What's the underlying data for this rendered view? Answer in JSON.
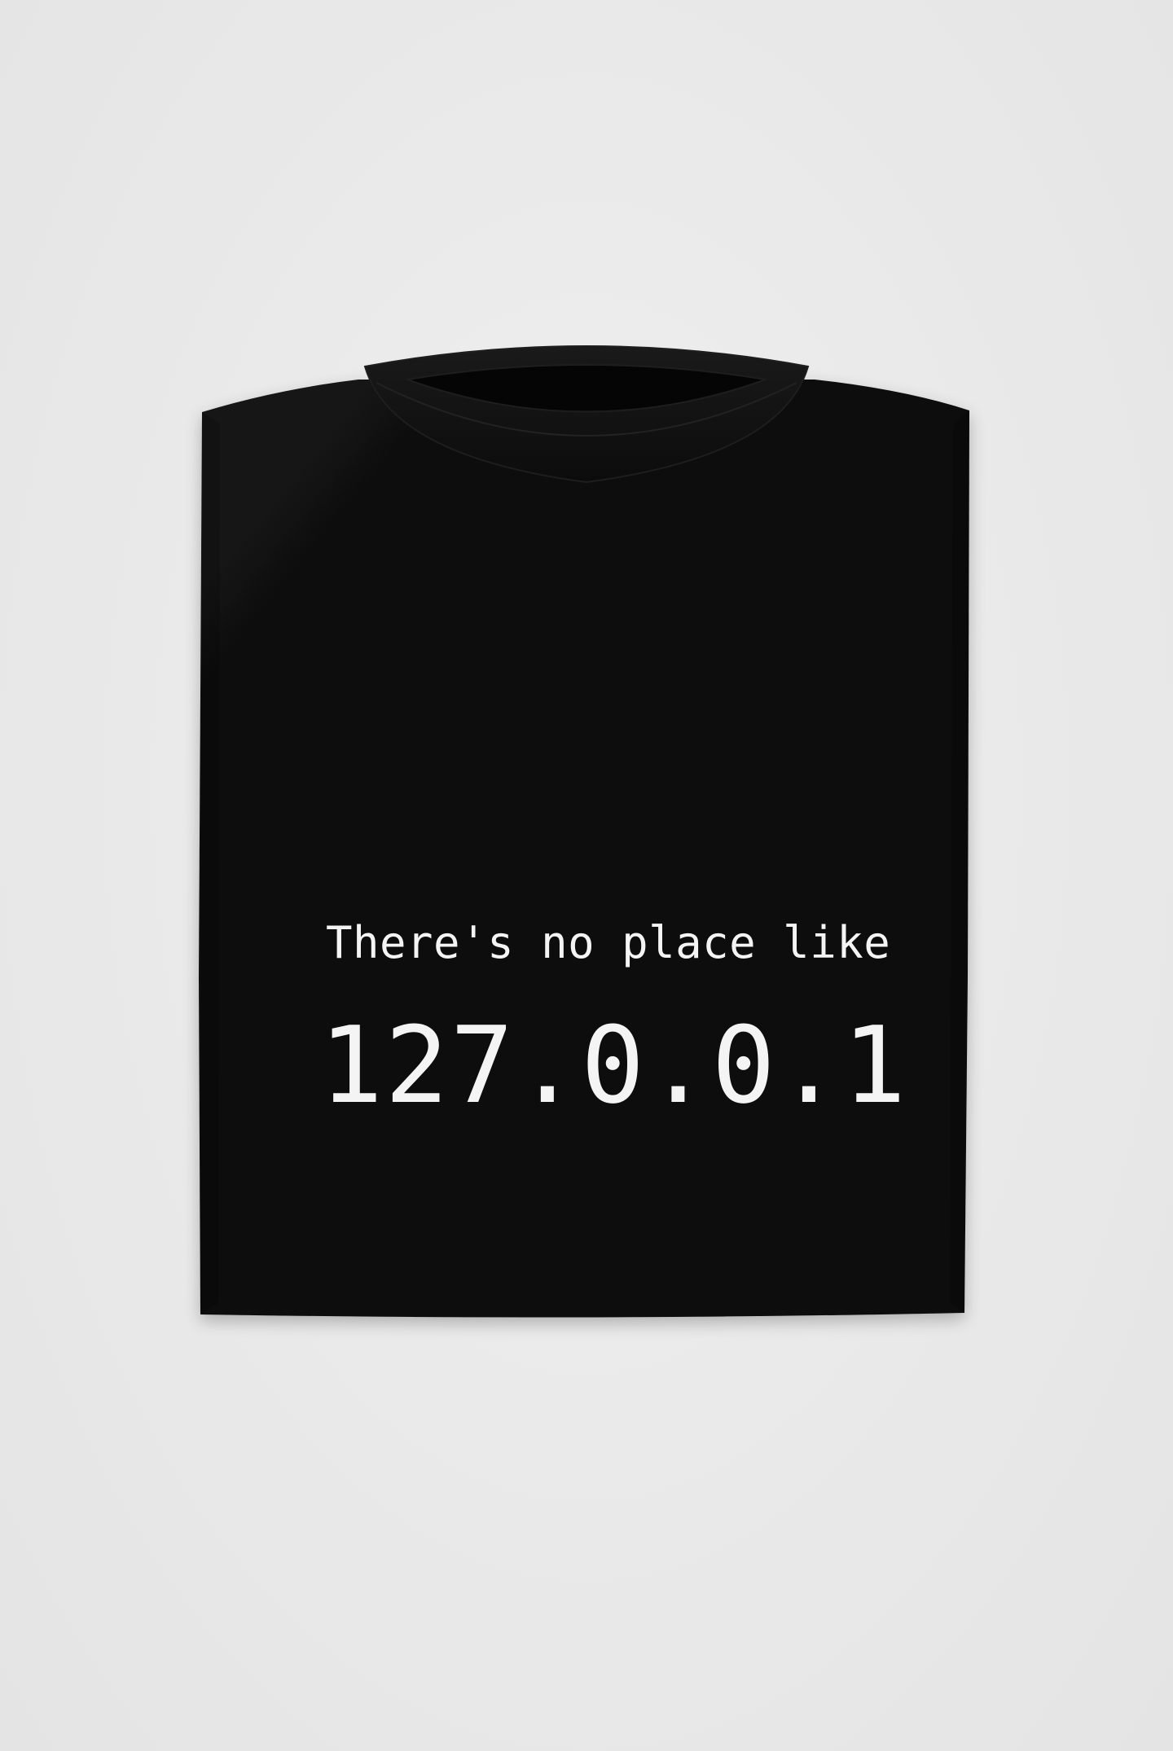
{
  "image": {
    "subject": "folded-tshirt",
    "background_color": "#ebebeb",
    "shirt_color": "#0b0b0b",
    "print_color": "#f4f4f4"
  },
  "print": {
    "line1": "There's no place like",
    "line2": "127.0.0.1"
  }
}
